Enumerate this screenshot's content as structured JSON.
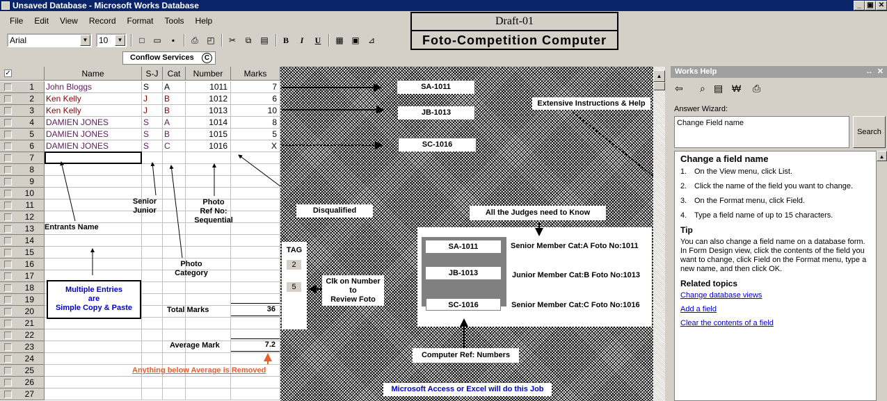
{
  "window": {
    "title": "Unsaved Database - Microsoft Works Database",
    "controls": [
      "_",
      "▣",
      "✕"
    ]
  },
  "menu": [
    "File",
    "Edit",
    "View",
    "Record",
    "Format",
    "Tools",
    "Help"
  ],
  "toolbar": {
    "font": "Arial",
    "size": "10",
    "bold": "B",
    "italic": "I",
    "underline": "U"
  },
  "draft": {
    "line1": "Draft-01",
    "line2": "Foto-Competition Computer"
  },
  "conflow": {
    "label": "Conflow Services",
    "symbol": "C"
  },
  "sheet": {
    "columns": [
      "Name",
      "S-J",
      "Cat",
      "Number",
      "Marks"
    ],
    "row_numbers": [
      "1",
      "2",
      "3",
      "4",
      "5",
      "6",
      "7",
      "8",
      "9",
      "10",
      "11",
      "12",
      "13",
      "14",
      "15",
      "16",
      "17",
      "18",
      "19",
      "20",
      "21",
      "22",
      "23",
      "24",
      "25",
      "26",
      "27"
    ],
    "records": [
      {
        "name": "John Bloggs",
        "sj": "S",
        "cat": "A",
        "number": "1011",
        "marks": "7"
      },
      {
        "name": "Ken Kelly",
        "sj": "J",
        "cat": "B",
        "number": "1012",
        "marks": "6"
      },
      {
        "name": "Ken Kelly",
        "sj": "J",
        "cat": "B",
        "number": "1013",
        "marks": "10"
      },
      {
        "name": "DAMIEN JONES",
        "sj": "S",
        "cat": "A",
        "number": "1014",
        "marks": "8"
      },
      {
        "name": "DAMIEN JONES",
        "sj": "S",
        "cat": "B",
        "number": "1015",
        "marks": "5"
      },
      {
        "name": "DAMIEN JONES",
        "sj": "S",
        "cat": "C",
        "number": "1016",
        "marks": "X"
      }
    ],
    "total_label": "Total Marks",
    "total_value": "36",
    "average_label": "Average Mark",
    "average_value": "7.2"
  },
  "annotations": {
    "senior_junior": "Senior\nJunior",
    "photo_ref": "Photo\nRef No:\nSequential",
    "entrants_name": "Entrants Name",
    "photo_category": "Photo\nCategory",
    "multiple_entries": "Multiple Entries\nare\nSimple Copy & Paste",
    "below_average": "Anything below Average is Removed",
    "disqualified": "Disqualified",
    "extensive": "Extensive Instructions & Help",
    "judges": "All the Judges need to Know",
    "tag": "TAG",
    "tag_values": [
      "2",
      "5"
    ],
    "click_number": "Clk on Number\nto\nReview Foto",
    "computer_ref": "Computer Ref: Numbers",
    "access_excel": "Microsoft Access or Excel will do this Job",
    "ref_codes": [
      "SA-1011",
      "JB-1013",
      "SC-1016"
    ],
    "judge_rows": [
      {
        "code": "SA-1011",
        "desc": "Senior Member Cat:A  Foto No:1011"
      },
      {
        "code": "JB-1013",
        "desc": "Junior Member Cat:B  Foto No:1013"
      },
      {
        "code": "SC-1016",
        "desc": "Senior Member Cat:C  Foto No:1016"
      }
    ]
  },
  "help": {
    "pane_title": "Works Help",
    "answer_wizard": "Answer Wizard:",
    "query": "Change Field name",
    "search": "Search",
    "heading": "Change a field name",
    "steps": [
      {
        "n": "1.",
        "text": "On the View menu, click List."
      },
      {
        "n": "2.",
        "text": "Click the name of the field you want to change."
      },
      {
        "n": "3.",
        "text": "On the Format menu, click Field."
      },
      {
        "n": "4.",
        "text": "Type a field name of up to 15 characters."
      }
    ],
    "tip_title": "Tip",
    "tip": "You can also change a field name on a database form. In Form Design view, click the contents of the field you want to change, click Field on the Format menu, type a new name, and then click OK.",
    "related_title": "Related topics",
    "related": [
      "Change database views",
      "Add a field",
      "Clear the contents of a field"
    ]
  },
  "colors": {
    "titlebar": "#0a246a",
    "sheet_text_red": "#8b0000",
    "link": "#0000cc",
    "warning": "#e8602c"
  }
}
